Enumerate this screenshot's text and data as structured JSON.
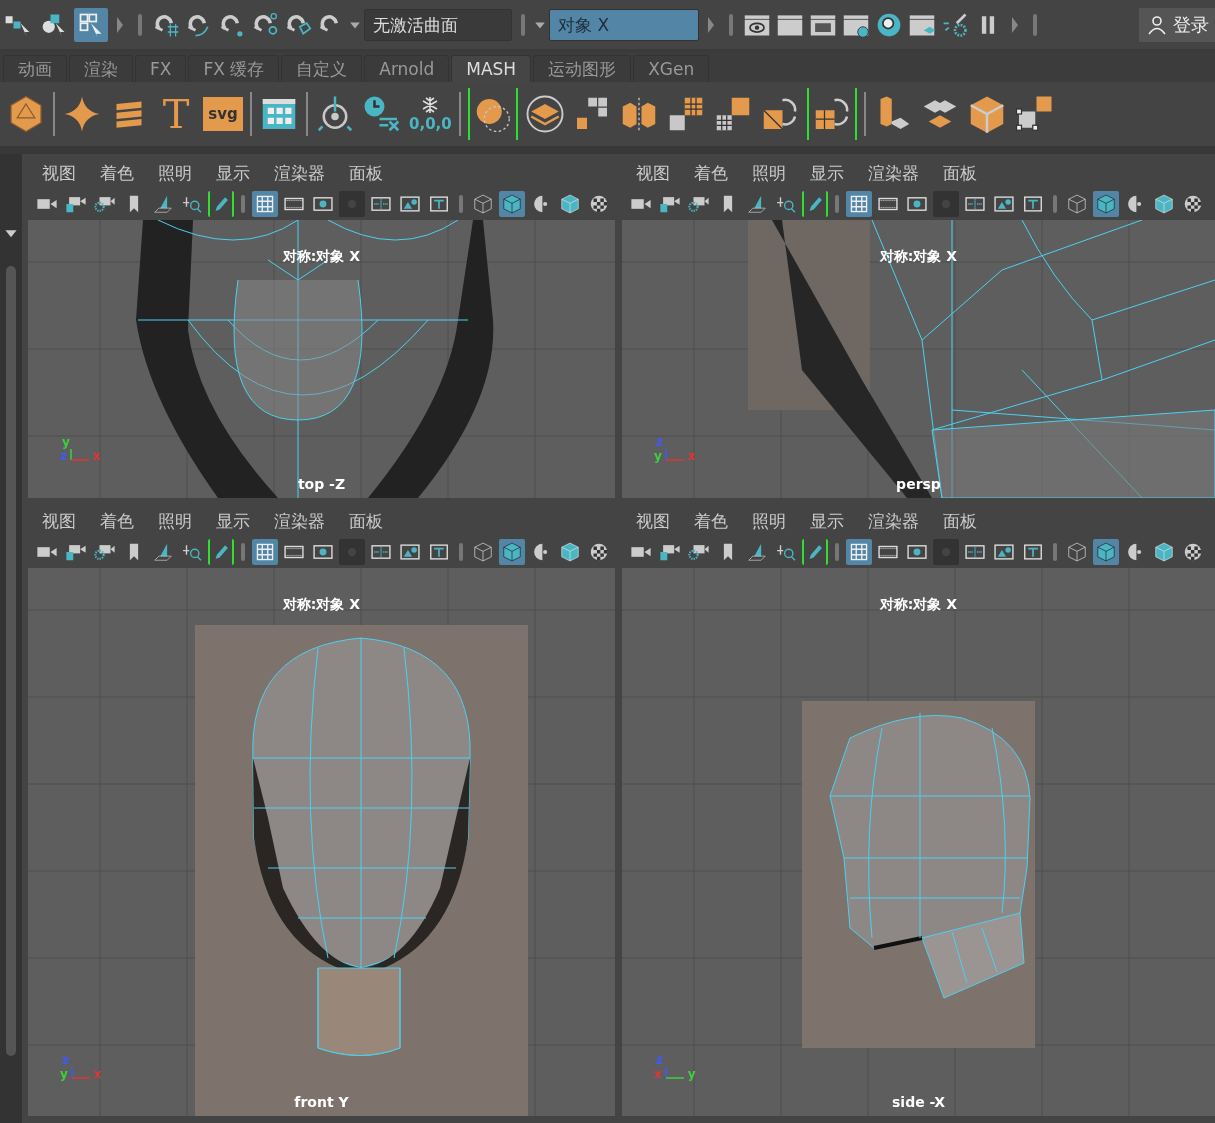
{
  "status_line": {
    "select_modes": [
      {
        "selected": false
      },
      {
        "selected": false
      },
      {
        "selected": true
      }
    ],
    "curve_field": {
      "value": "无激活曲面"
    },
    "symmetry_field": {
      "value": "对象 X",
      "on": true
    },
    "login": {
      "label": "登录"
    }
  },
  "shelf_tabs": [
    {
      "label": "动画",
      "selected": false
    },
    {
      "label": "渲染",
      "selected": false
    },
    {
      "label": "FX",
      "selected": false
    },
    {
      "label": "FX 缓存",
      "selected": false
    },
    {
      "label": "自定义",
      "selected": false
    },
    {
      "label": "Arnold",
      "selected": false
    },
    {
      "label": "MASH",
      "selected": true
    },
    {
      "label": "运动图形",
      "selected": false
    },
    {
      "label": "XGen",
      "selected": false
    }
  ],
  "shelf_items": [
    {
      "kind": "polyhedron"
    },
    {
      "kind": "sep"
    },
    {
      "kind": "sparkle"
    },
    {
      "kind": "sweep"
    },
    {
      "kind": "type",
      "label": "T"
    },
    {
      "kind": "svg",
      "label": "svg"
    },
    {
      "kind": "sep"
    },
    {
      "kind": "browser"
    },
    {
      "kind": "sep"
    },
    {
      "kind": "pivot"
    },
    {
      "kind": "history"
    },
    {
      "kind": "freeze",
      "label": "0,0,0"
    },
    {
      "kind": "sep"
    },
    {
      "kind": "sphere"
    },
    {
      "kind": "plane"
    },
    {
      "kind": "blocks"
    },
    {
      "kind": "mirror"
    },
    {
      "kind": "grids"
    },
    {
      "kind": "grids2"
    },
    {
      "kind": "rotate"
    },
    {
      "kind": "rotate2"
    },
    {
      "kind": "sep"
    },
    {
      "kind": "extrude"
    },
    {
      "kind": "layers"
    },
    {
      "kind": "cube"
    },
    {
      "kind": "uv"
    }
  ],
  "viewports": [
    {
      "kind": "top",
      "menu": [
        "视图",
        "着色",
        "照明",
        "显示",
        "渲染器",
        "面板"
      ],
      "grid_visible": true,
      "shaded": true,
      "hud": "对称:对象 X",
      "camera": "top -Z",
      "axes": [
        {
          "label": "y",
          "color": "#3cd23c"
        },
        {
          "label": "z",
          "color": "#3c5aff"
        },
        {
          "label": "x",
          "color": "#e23434"
        }
      ]
    },
    {
      "kind": "persp",
      "menu": [
        "视图",
        "着色",
        "照明",
        "显示",
        "渲染器",
        "面板"
      ],
      "grid_visible": true,
      "shaded": true,
      "hud": "对称:对象 X",
      "camera": "persp",
      "axes": [
        {
          "label": "z",
          "color": "#3c5aff"
        },
        {
          "label": "y",
          "color": "#3cd23c"
        },
        {
          "label": "x",
          "color": "#e23434"
        }
      ]
    },
    {
      "kind": "front",
      "menu": [
        "视图",
        "着色",
        "照明",
        "显示",
        "渲染器",
        "面板"
      ],
      "grid_visible": true,
      "shaded": true,
      "hud": "对称:对象 X",
      "camera": "front Y",
      "axes": [
        {
          "label": "z",
          "color": "#3c5aff"
        },
        {
          "label": "y",
          "color": "#3cd23c"
        },
        {
          "label": "x",
          "color": "#e23434"
        }
      ]
    },
    {
      "kind": "side",
      "menu": [
        "视图",
        "着色",
        "照明",
        "显示",
        "渲染器",
        "面板"
      ],
      "grid_visible": true,
      "shaded": true,
      "hud": "对称:对象 X",
      "camera": "side -X",
      "axes": [
        {
          "label": "z",
          "color": "#3c5aff"
        },
        {
          "label": "x",
          "color": "#e23434"
        },
        {
          "label": "y",
          "color": "#3cd23c"
        }
      ]
    }
  ]
}
